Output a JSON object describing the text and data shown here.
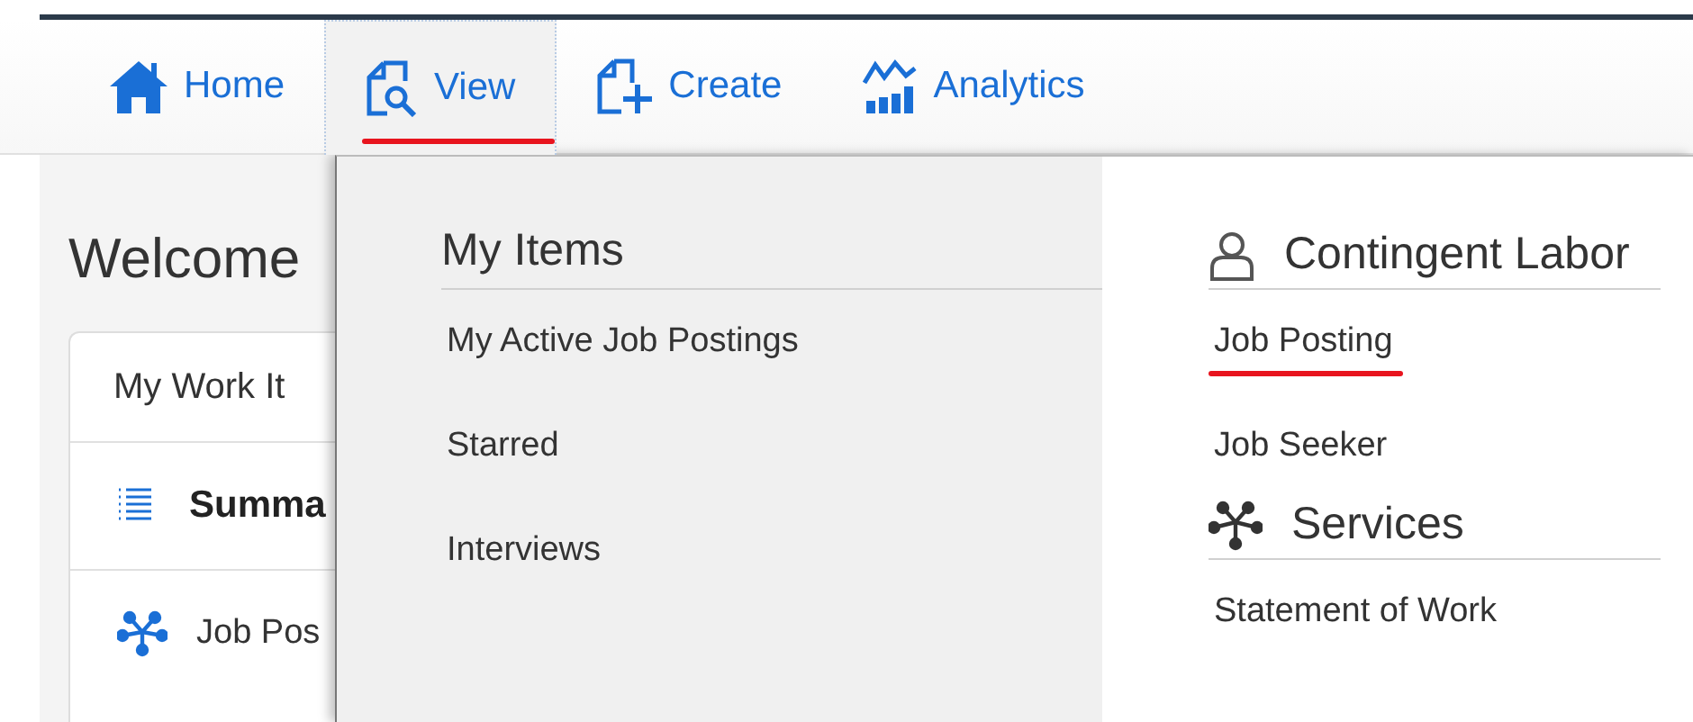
{
  "nav": [
    {
      "label": "Home",
      "kind": "home",
      "selected": false,
      "underlined": false
    },
    {
      "label": "View",
      "kind": "view",
      "selected": true,
      "underlined": true
    },
    {
      "label": "Create",
      "kind": "create",
      "selected": false,
      "underlined": false
    },
    {
      "label": "Analytics",
      "kind": "analytics",
      "selected": false,
      "underlined": false
    }
  ],
  "page": {
    "title": "Welcome",
    "card_title": "My Work It",
    "summary": "Summa",
    "row": "Job Pos"
  },
  "menu": {
    "my_items": {
      "title": "My Items",
      "items": [
        "My Active Job Postings",
        "Starred",
        "Interviews"
      ]
    },
    "sections": [
      {
        "title": "Contingent Labor",
        "kind": "people",
        "links": [
          {
            "label": "Job Posting",
            "underlined": true
          },
          {
            "label": "Job Seeker",
            "underlined": false
          }
        ]
      },
      {
        "title": "Services",
        "kind": "services",
        "links": [
          {
            "label": "Statement of Work",
            "underlined": false
          }
        ]
      }
    ]
  }
}
